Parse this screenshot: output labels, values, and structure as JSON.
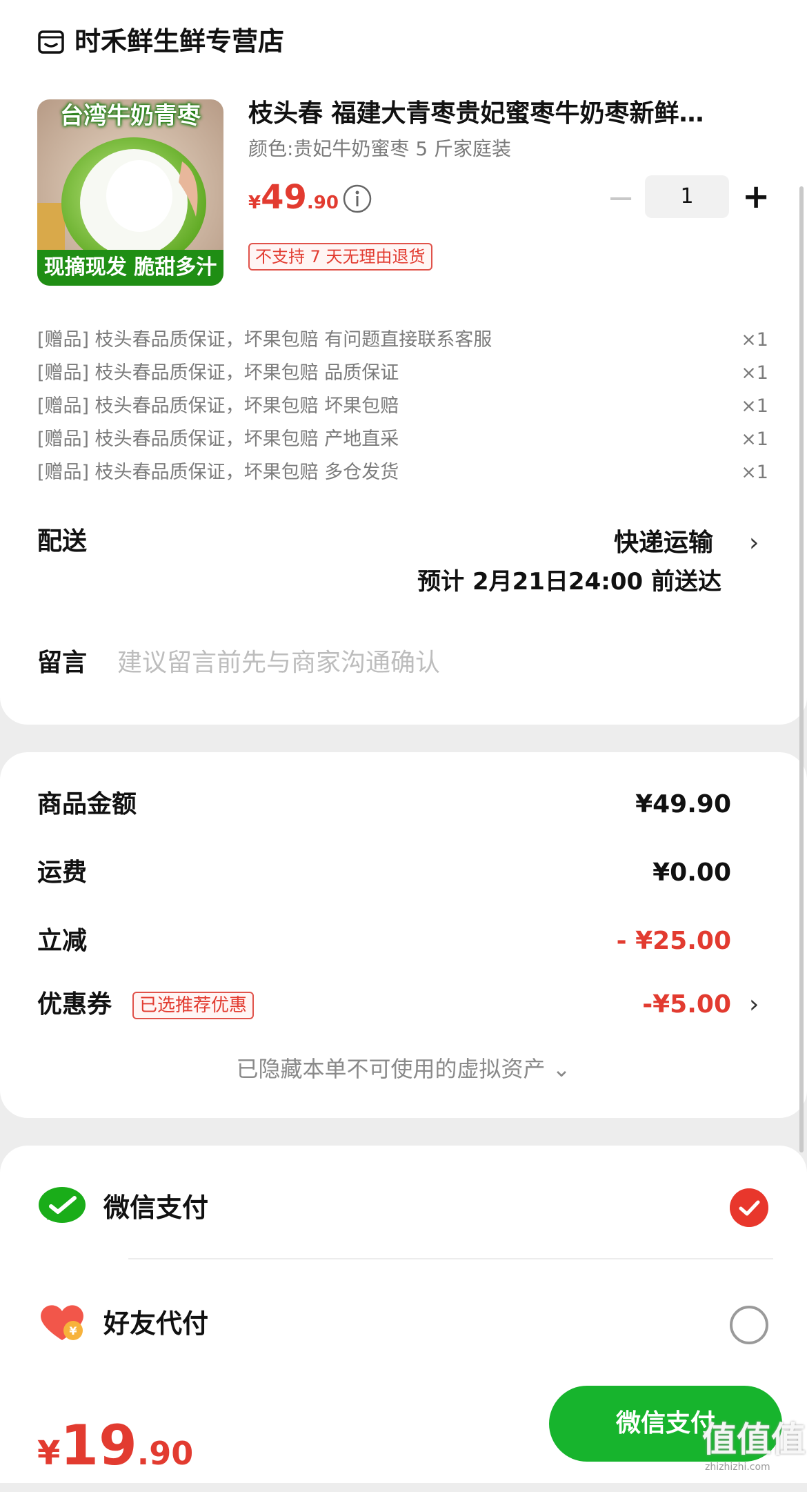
{
  "store": {
    "name": "时禾鲜生鲜专营店",
    "icon": "store-icon"
  },
  "product": {
    "image_top_text": "台湾牛奶青枣",
    "image_bottom_text": "现摘现发 脆甜多汁",
    "title": "枝头春 福建大青枣贵妃蜜枣牛奶枣新鲜…",
    "spec": "颜色:贵妃牛奶蜜枣 5 斤家庭装",
    "price_symbol": "¥",
    "price_int": "49",
    "price_dec": ".90",
    "quantity": "1",
    "minus_label": "−",
    "plus_label": "+",
    "return_policy": "不支持 7 天无理由退货"
  },
  "gifts": [
    {
      "text": "[赠品] 枝头春品质保证，坏果包赔 有问题直接联系客服",
      "qty": "×1"
    },
    {
      "text": "[赠品] 枝头春品质保证，坏果包赔 品质保证",
      "qty": "×1"
    },
    {
      "text": "[赠品] 枝头春品质保证，坏果包赔 坏果包赔",
      "qty": "×1"
    },
    {
      "text": "[赠品] 枝头春品质保证，坏果包赔 产地直采",
      "qty": "×1"
    },
    {
      "text": "[赠品] 枝头春品质保证，坏果包赔 多仓发货",
      "qty": "×1"
    }
  ],
  "shipping": {
    "label": "配送",
    "method": "快递运输",
    "chevron": "›",
    "eta": "预计 2月21日24:00 前送达"
  },
  "message": {
    "label": "留言",
    "placeholder": "建议留言前先与商家沟通确认",
    "value": ""
  },
  "summary": {
    "goods_label": "商品金额",
    "goods_value": "¥49.90",
    "freight_label": "运费",
    "freight_value": "¥0.00",
    "discount_label": "立减",
    "discount_value": "- ¥25.00",
    "coupon_label": "优惠券",
    "coupon_badge": "已选推荐优惠",
    "coupon_value": "-¥5.00",
    "coupon_chevron": "›",
    "hidden_assets": "已隐藏本单不可使用的虚拟资产 ⌄"
  },
  "payment": {
    "options": [
      {
        "label": "微信支付",
        "selected": true,
        "icon": "wechat-pay-icon"
      },
      {
        "label": "好友代付",
        "selected": false,
        "icon": "friend-pay-icon"
      }
    ]
  },
  "footer": {
    "total_symbol": "¥",
    "total_int": "19",
    "total_dec": ".90",
    "pay_button": "微信支付"
  },
  "watermark": {
    "text": "值值值",
    "sub": "zhizhizhi.com"
  },
  "colors": {
    "accent_green": "#17b42d",
    "price_red": "#e23b30",
    "badge_border": "#e0524a"
  }
}
